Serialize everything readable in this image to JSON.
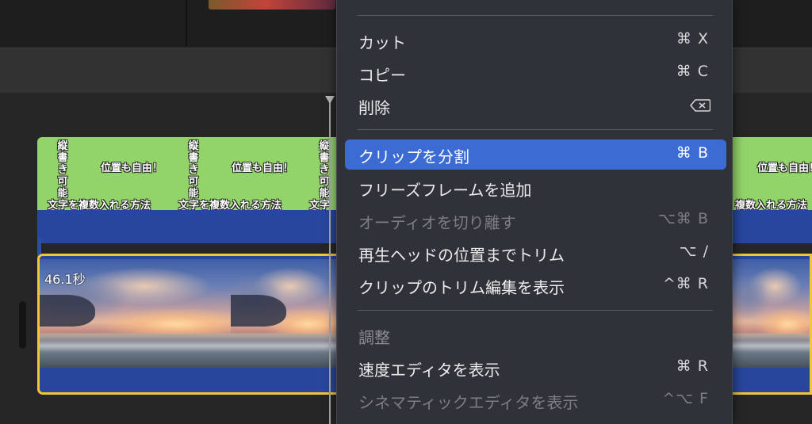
{
  "timeline": {
    "title_clip": {
      "vertical_text": "縦書き可能",
      "position_text": "位置も自由！",
      "bottom_text": "文字を複数入れる方法",
      "bottom_text_partial": "文字",
      "bottom_text_right": "複数入れる方法"
    },
    "video_clip": {
      "duration": "46.1秒"
    }
  },
  "menu": {
    "items": [
      {
        "label": "カット",
        "shortcut": "⌘ X"
      },
      {
        "label": "コピー",
        "shortcut": "⌘ C"
      },
      {
        "label": "削除",
        "shortcut": ""
      },
      {
        "label": "クリップを分割",
        "shortcut": "⌘ B"
      },
      {
        "label": "フリーズフレームを追加",
        "shortcut": ""
      },
      {
        "label": "オーディオを切り離す",
        "shortcut": "⌥⌘ B"
      },
      {
        "label": "再生ヘッドの位置までトリム",
        "shortcut": "⌥ /"
      },
      {
        "label": "クリップのトリム編集を表示",
        "shortcut": "^⌘ R"
      },
      {
        "label": "速度エディタを表示",
        "shortcut": "⌘ R"
      },
      {
        "label": "シネマティックエディタを表示",
        "shortcut": "^⌥ F"
      }
    ],
    "section_header": "調整",
    "icons": {
      "delete": "delete-backward-icon"
    },
    "colors": {
      "highlight": "#3c6bd3",
      "background": "#31333a"
    }
  }
}
